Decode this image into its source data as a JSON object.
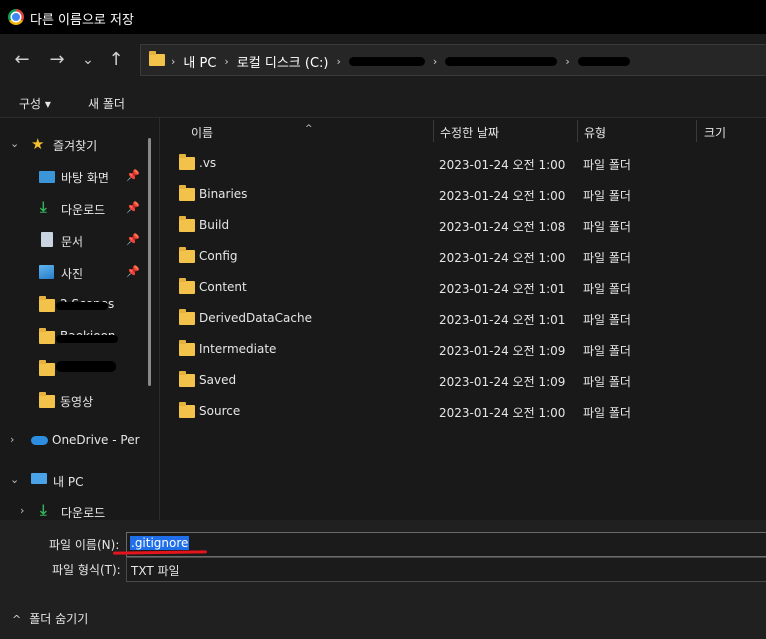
{
  "window": {
    "title": "다른 이름으로 저장"
  },
  "nav": {
    "back_icon": "←",
    "forward_icon": "→",
    "recent_icon": "⌄",
    "up_icon": "↑",
    "breadcrumb": [
      "내 PC",
      "로컬 디스크 (C:)"
    ]
  },
  "toolbar": {
    "organize_label": "구성 ▾",
    "new_folder_label": "새 폴더"
  },
  "sidebar": {
    "quick_access": "즐겨찾기",
    "items": [
      {
        "label": "바탕 화면",
        "icon": "desktop-icon",
        "pinned": true
      },
      {
        "label": "다운로드",
        "icon": "download-icon",
        "pinned": true
      },
      {
        "label": "문서",
        "icon": "document-icon",
        "pinned": true
      },
      {
        "label": "사진",
        "icon": "picture-icon",
        "pinned": true
      },
      {
        "label": "2.Scenes",
        "icon": "folder-icon",
        "pinned": false
      },
      {
        "label": "Baekjoon",
        "icon": "folder-icon",
        "pinned": false
      },
      {
        "label": "",
        "icon": "folder-icon",
        "pinned": false
      },
      {
        "label": "동영상",
        "icon": "folder-icon",
        "pinned": false
      }
    ],
    "onedrive": "OneDrive - Perso",
    "this_pc": "내 PC",
    "this_pc_download": "다운로드"
  },
  "columns": {
    "name": "이름",
    "modified": "수정한 날짜",
    "type": "유형",
    "size": "크기"
  },
  "files": [
    {
      "name": ".vs",
      "modified": "2023-01-24 오전 1:00",
      "type": "파일 폴더"
    },
    {
      "name": "Binaries",
      "modified": "2023-01-24 오전 1:00",
      "type": "파일 폴더"
    },
    {
      "name": "Build",
      "modified": "2023-01-24 오전 1:08",
      "type": "파일 폴더"
    },
    {
      "name": "Config",
      "modified": "2023-01-24 오전 1:00",
      "type": "파일 폴더"
    },
    {
      "name": "Content",
      "modified": "2023-01-24 오전 1:01",
      "type": "파일 폴더"
    },
    {
      "name": "DerivedDataCache",
      "modified": "2023-01-24 오전 1:01",
      "type": "파일 폴더"
    },
    {
      "name": "Intermediate",
      "modified": "2023-01-24 오전 1:09",
      "type": "파일 폴더"
    },
    {
      "name": "Saved",
      "modified": "2023-01-24 오전 1:09",
      "type": "파일 폴더"
    },
    {
      "name": "Source",
      "modified": "2023-01-24 오전 1:00",
      "type": "파일 폴더"
    }
  ],
  "save": {
    "filename_label": "파일 이름(N):",
    "filename_value": ".gitignore",
    "filetype_label": "파일 형식(T):",
    "filetype_value": "TXT 파일",
    "hide_folders_label": "폴더 숨기기"
  },
  "colors": {
    "accent": "#1f6feb",
    "folder": "#f3c24a",
    "annotation_red": "#e3141b",
    "star": "#f5c030"
  }
}
